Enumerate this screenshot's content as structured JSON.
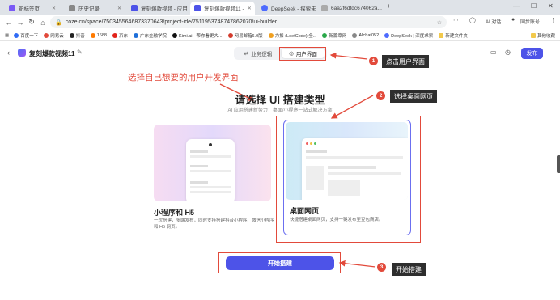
{
  "browser": {
    "tabs": [
      {
        "label": "新标签页",
        "color": "#7a5af5"
      },
      {
        "label": "历史记录",
        "color": "#888888"
      },
      {
        "label": "复刻爆款视频 - 应用",
        "color": "#4d53e8"
      },
      {
        "label": "复刻爆款视频11 -",
        "color": "#4d53e8"
      },
      {
        "label": "DeepSeek - 探索未至",
        "color": "#4d6bfe"
      },
      {
        "label": "6aa2f6dfdc674062a...",
        "color": "#aaaaaa"
      }
    ],
    "url": "coze.cn/space/7503455646873370643/project-ide/7511953748747862070/ui-builder",
    "ai_button": "AI 对话",
    "profile_label": "同步账号",
    "bookmarks": [
      {
        "label": "百度一下",
        "color": "#2f6bf5"
      },
      {
        "label": "网易云",
        "color": "#e24a3b"
      },
      {
        "label": "抖音",
        "color": "#222222"
      },
      {
        "label": "1688",
        "color": "#ff7a00"
      },
      {
        "label": "京东",
        "color": "#e2231a"
      },
      {
        "label": "广东金融学院",
        "color": "#1e6fd9"
      },
      {
        "label": "Kimi.ai - 帮你看更大...",
        "color": "#111111"
      },
      {
        "label": "网易邮箱6.0版",
        "color": "#d33b2c"
      },
      {
        "label": "力扣 (LeetCode) 全...",
        "color": "#f0a020"
      },
      {
        "label": "新篇章网",
        "color": "#2aa84a"
      },
      {
        "label": "AIchat052",
        "color": "#888888"
      },
      {
        "label": "DeepSeek | 深度求索",
        "color": "#4d6bfe"
      },
      {
        "label": "新建文件夹",
        "color": "#f2c94c"
      }
    ],
    "other_bookmarks": "其他收藏"
  },
  "app": {
    "name": "复刻爆款视频11",
    "tabs": {
      "logic": "业务逻辑",
      "ui": "用户界面"
    },
    "publish": "发布"
  },
  "main": {
    "title": "请选择 UI 搭建类型",
    "subtitle": "AI 应用搭建新势力：桌面/小程序一站式解决方案",
    "cards": [
      {
        "title": "小程序和 H5",
        "desc": "一次搭建，多端发布，同时支持搭建抖音小程序、微信小程序和 H5 网页。"
      },
      {
        "title": "桌面网页",
        "desc": "快捷搭建桌面网页，支持一键发布至豆包商店。"
      }
    ],
    "start_button": "开始搭建"
  },
  "annotations": {
    "note": "选择自己想要的用户开发界面",
    "callouts": [
      {
        "num": "1",
        "label": "点击用户界面"
      },
      {
        "num": "2",
        "label": "选择桌面网页"
      },
      {
        "num": "3",
        "label": "开始搭建"
      }
    ],
    "color": "#e24a3b"
  }
}
